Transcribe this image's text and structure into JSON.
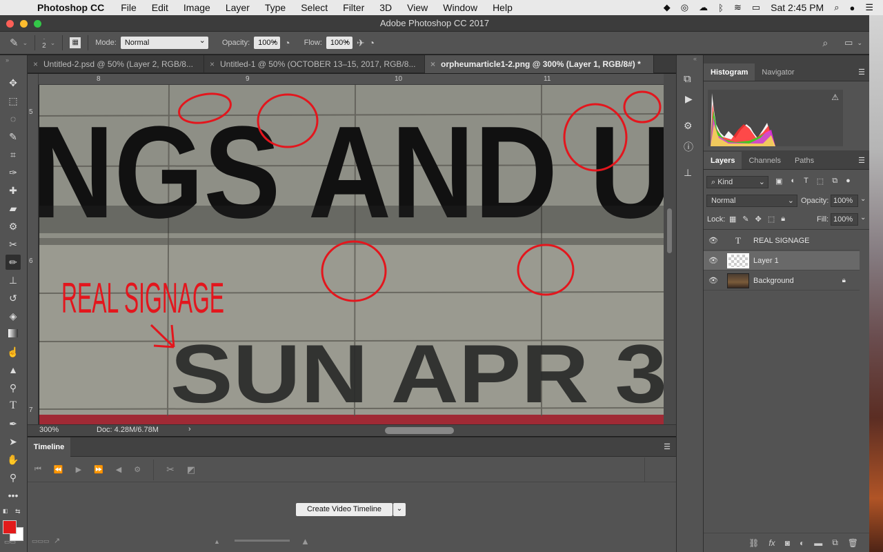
{
  "menubar": {
    "app_name": "Photoshop CC",
    "items": [
      "File",
      "Edit",
      "Image",
      "Layer",
      "Type",
      "Select",
      "Filter",
      "3D",
      "View",
      "Window",
      "Help"
    ],
    "clock": "Sat 2:45 PM"
  },
  "window": {
    "title": "Adobe Photoshop CC 2017"
  },
  "options": {
    "brush_size": "2",
    "mode_label": "Mode:",
    "mode_value": "Normal",
    "opacity_label": "Opacity:",
    "opacity_value": "100%",
    "flow_label": "Flow:",
    "flow_value": "100%"
  },
  "tabs": [
    {
      "label": "Untitled-2.psd @ 50% (Layer 2, RGB/8..."
    },
    {
      "label": "Untitled-1 @ 50% (OCTOBER 13–15, 2017, RGB/8..."
    },
    {
      "label": "orpheumarticle1-2.png @ 300% (Layer 1, RGB/8#) *"
    }
  ],
  "ruler": {
    "top": [
      "8",
      "9",
      "10",
      "11"
    ],
    "left": [
      "5",
      "6",
      "7"
    ]
  },
  "canvas": {
    "sign_top": "NGS AND U",
    "sign_bottom": "SUN APR 3",
    "annotation": "REAL SIGNAGE"
  },
  "status": {
    "zoom": "300%",
    "doc": "Doc: 4.28M/6.78M"
  },
  "timeline": {
    "title": "Timeline",
    "create_button": "Create Video Timeline"
  },
  "histogram_panel": {
    "tabs": [
      "Histogram",
      "Navigator"
    ]
  },
  "layers_panel": {
    "tabs": [
      "Layers",
      "Channels",
      "Paths"
    ],
    "filter_value": "Kind",
    "blend_value": "Normal",
    "opacity_label": "Opacity:",
    "opacity_value": "100%",
    "lock_label": "Lock:",
    "fill_label": "Fill:",
    "fill_value": "100%",
    "layers": [
      {
        "name": "REAL SIGNAGE",
        "kind": "text"
      },
      {
        "name": "Layer 1",
        "kind": "pixel",
        "selected": true
      },
      {
        "name": "Background",
        "kind": "image",
        "locked": true
      }
    ]
  },
  "colors": {
    "foreground": "#e21b1b",
    "background": "#ffffff",
    "annotation_red": "#e3161d"
  }
}
